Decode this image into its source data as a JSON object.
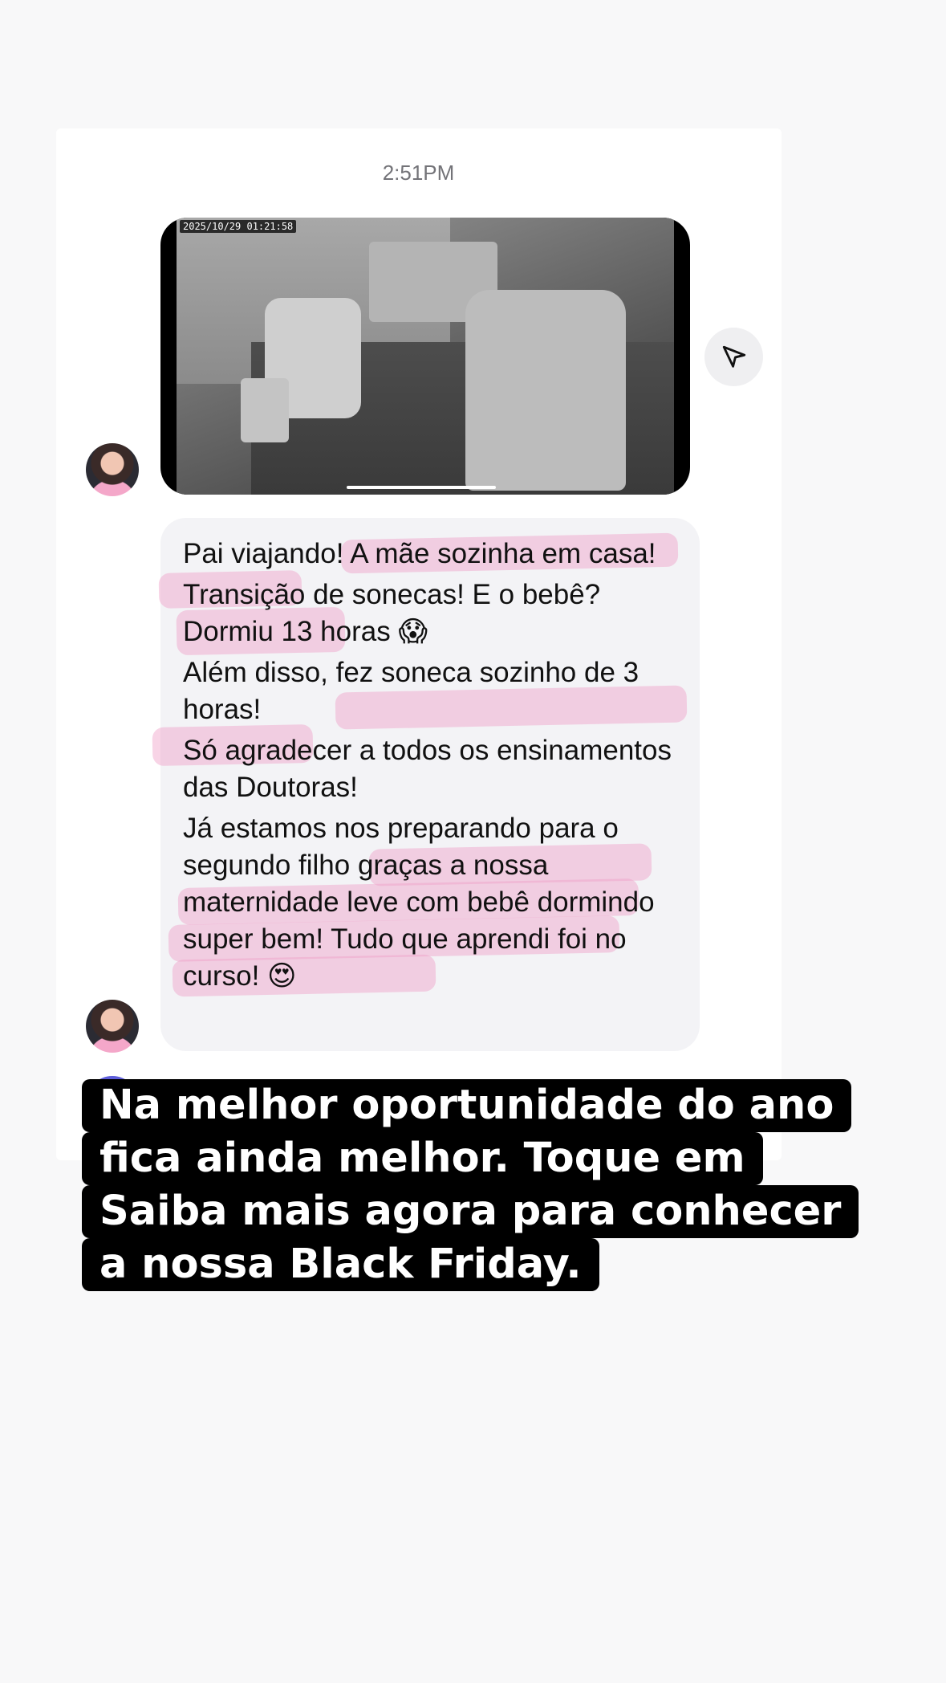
{
  "chat": {
    "timestamp": "2:51PM",
    "video": {
      "camera_timestamp": "2025/10/29  01:21:58",
      "progress": 0.3
    },
    "share_icon": "paper-plane-icon",
    "message_lines": [
      "Pai viajando! A mãe sozinha em casa!",
      "Transição de sonecas! E o bebê? Dormiu 13 horas 😱",
      "Além disso, fez soneca sozinho de 3 horas!",
      "Só agradecer a todos os ensinamentos das Doutoras!",
      "Já estamos nos preparando para o segundo filho graças a nossa maternidade leve com bebê dormindo super bem! Tudo que aprendi foi no curso! 😍"
    ],
    "highlight_color": "#f0a0c8"
  },
  "overlay": {
    "lines": [
      "Na melhor oportunidade do ano",
      "fica ainda melhor. Toque em",
      "Saiba mais agora para conhecer",
      "a nossa Black Friday."
    ]
  }
}
